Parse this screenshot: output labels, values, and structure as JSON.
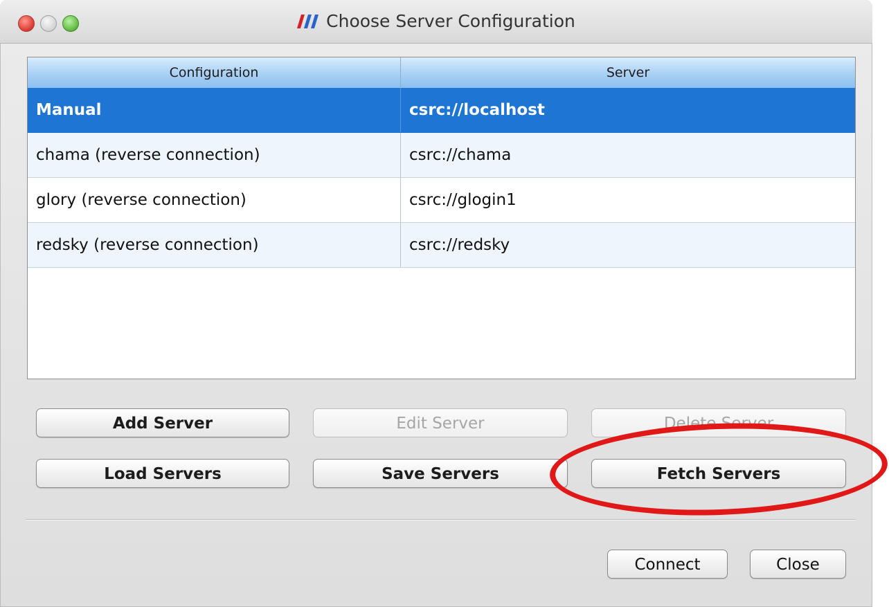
{
  "window": {
    "title": "Choose Server Configuration"
  },
  "icons": {
    "app": "paraview-logo-icon",
    "close": "window-close-icon",
    "minimize": "window-minimize-icon",
    "zoom": "window-zoom-icon"
  },
  "colors": {
    "selection": "#1e75d4",
    "header": "#a8d0f4",
    "annotation": "#e01818"
  },
  "table": {
    "columns": [
      "Configuration",
      "Server"
    ],
    "rows": [
      {
        "configuration": "Manual",
        "server": "csrc://localhost",
        "selected": true
      },
      {
        "configuration": "chama (reverse connection)",
        "server": "csrc://chama",
        "selected": false
      },
      {
        "configuration": "glory (reverse connection)",
        "server": "csrc://glogin1",
        "selected": false
      },
      {
        "configuration": "redsky (reverse connection)",
        "server": "csrc://redsky",
        "selected": false
      }
    ]
  },
  "buttons": {
    "add": "Add Server",
    "edit": "Edit Server",
    "delete": "Delete Server",
    "load": "Load Servers",
    "save": "Save Servers",
    "fetch": "Fetch Servers",
    "connect": "Connect",
    "close": "Close"
  }
}
